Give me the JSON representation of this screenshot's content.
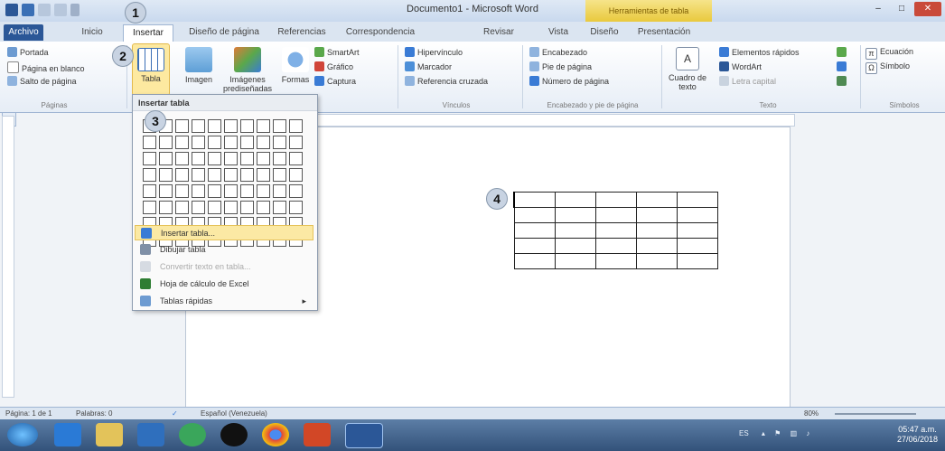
{
  "window": {
    "title": "Documento1 - Microsoft Word",
    "contextual_tab": "Herramientas de tabla",
    "min": "–",
    "max": "□",
    "close": "✕"
  },
  "tabs": [
    "Archivo",
    "Inicio",
    "Insertar",
    "Diseño de página",
    "Referencias",
    "Correspondencia",
    "Revisar",
    "Vista",
    "Diseño",
    "Presentación"
  ],
  "ribbon": {
    "paginas": {
      "items": [
        "Portada",
        "Página en blanco",
        "Salto de página"
      ],
      "label": "Páginas"
    },
    "tabla": {
      "label": "Tabla"
    },
    "imagen": {
      "label": "Imagen"
    },
    "imagenes_pred": {
      "label": "Imágenes prediseñadas"
    },
    "formas": {
      "label": "Formas"
    },
    "smartart": [
      "SmartArt",
      "Gráfico",
      "Captura"
    ],
    "vinculos": {
      "items": [
        "Hipervínculo",
        "Marcador",
        "Referencia cruzada"
      ],
      "label": "Vínculos"
    },
    "encabezado": {
      "items": [
        "Encabezado",
        "Pie de página",
        "Número de página"
      ],
      "label": "Encabezado y pie de página"
    },
    "texto": {
      "cuadro": "Cuadro de texto",
      "items": [
        "Elementos rápidos",
        "WordArt",
        "Letra capital"
      ],
      "label": "Texto"
    },
    "simbolos": {
      "items": [
        "Ecuación",
        "Símbolo"
      ],
      "label": "Símbolos"
    }
  },
  "dropdown": {
    "header": "Insertar tabla",
    "grid_cols": 10,
    "grid_rows": 8,
    "items": [
      {
        "label": "Insertar tabla...",
        "highlight": true
      },
      {
        "label": "Dibujar tabla",
        "highlight": false
      },
      {
        "label": "Convertir texto en tabla...",
        "disabled": true
      },
      {
        "label": "Hoja de cálculo de Excel",
        "highlight": false
      },
      {
        "label": "Tablas rápidas",
        "submenu": true
      }
    ]
  },
  "doc_table": {
    "rows": 5,
    "cols": 5
  },
  "callouts": [
    "1",
    "2",
    "3",
    "4"
  ],
  "status": {
    "pagina": "Página: 1 de 1",
    "palabras": "Palabras: 0",
    "idioma": "Español (Venezuela)",
    "zoom": "80%"
  },
  "taskbar": {
    "lang": "ES",
    "time": "05:47 a.m.",
    "date": "27/06/2018"
  },
  "colors": {
    "accent": "#2b5797",
    "highlight": "#fbe9a4",
    "context": "#e9c93d"
  }
}
